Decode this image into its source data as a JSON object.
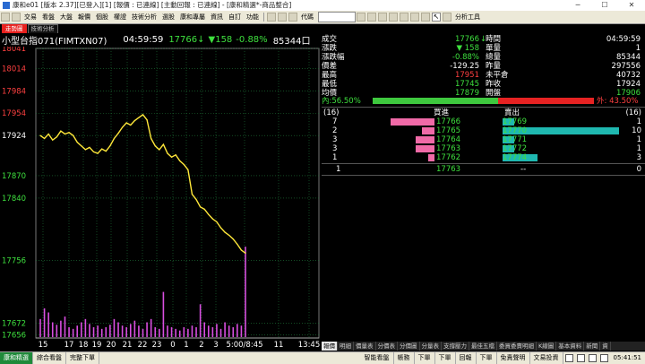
{
  "window": {
    "title": "康和e01 [版本 2.37][已登入][1] [報價 : 已連線] [主動回報 : 已連線] - [康和精選*-商品整合]",
    "minimize": "─",
    "maximize": "☐",
    "close": "✕"
  },
  "menu": {
    "items": [
      "交易",
      "看盤",
      "大盤",
      "報價",
      "個股",
      "權證",
      "技術分析",
      "選股",
      "康和專屬",
      "資訊",
      "自訂",
      "功能"
    ],
    "search_label": "代碼",
    "analysis_tools": "分析工具"
  },
  "tabs": [
    {
      "label": "走勢圖",
      "active": true
    },
    {
      "label": "技術分析",
      "active": false
    }
  ],
  "chart_header": {
    "name": "小型台指071(FIMTXN07)",
    "time": "04:59:59",
    "price": "17766",
    "arrow": "↓",
    "change": "▼158",
    "pct": "-0.88%",
    "volume": "85344口"
  },
  "chart_data": {
    "type": "line",
    "title": "",
    "xlabel": "",
    "ylabel": "",
    "ylim": [
      17652,
      18041
    ],
    "y_ticks": [
      "18041",
      "18014",
      "17984",
      "17954",
      "17924",
      "17870",
      "17840",
      "17756",
      "17672",
      "17656"
    ],
    "y_tick_values": [
      18041,
      18014,
      17984,
      17954,
      17924,
      17870,
      17840,
      17756,
      17672,
      17656
    ],
    "reference_price": 17924,
    "x_ticks": [
      "15",
      "17",
      "18",
      "19",
      "20",
      "21",
      "22",
      "23",
      "0",
      "1",
      "2",
      "3",
      "5:00/8:45",
      "11",
      "13:45"
    ],
    "price_series": [
      17924,
      17920,
      17926,
      17918,
      17922,
      17930,
      17926,
      17928,
      17924,
      17915,
      17910,
      17905,
      17908,
      17902,
      17900,
      17906,
      17903,
      17910,
      17920,
      17927,
      17935,
      17941,
      17938,
      17944,
      17948,
      17952,
      17945,
      17920,
      17910,
      17905,
      17912,
      17900,
      17895,
      17898,
      17890,
      17885,
      17878,
      17845,
      17838,
      17828,
      17825,
      17818,
      17812,
      17808,
      17800,
      17794,
      17790,
      17785,
      17778,
      17770,
      17766
    ],
    "volume_series": [
      22,
      35,
      30,
      18,
      15,
      20,
      25,
      12,
      10,
      14,
      18,
      22,
      16,
      12,
      14,
      10,
      12,
      15,
      22,
      18,
      14,
      12,
      16,
      20,
      14,
      10,
      18,
      22,
      12,
      10,
      55,
      14,
      12,
      10,
      8,
      12,
      10,
      14,
      12,
      40,
      18,
      14,
      12,
      16,
      10,
      18,
      14,
      12,
      16,
      14,
      110
    ],
    "volume_max": 120
  },
  "quote": {
    "left": [
      {
        "label": "成交",
        "value": "17766",
        "arrow": "↓",
        "color": "green"
      },
      {
        "label": "漲跌",
        "value": "▼ 158",
        "color": "green"
      },
      {
        "label": "漲跌幅",
        "value": "-0.88%",
        "color": "green"
      },
      {
        "label": "價差",
        "value": "-129.25",
        "color": "white"
      },
      {
        "label": "最高",
        "value": "17951",
        "color": "red"
      },
      {
        "label": "最低",
        "value": "17745",
        "color": "green"
      },
      {
        "label": "均價",
        "value": "17879",
        "color": "green"
      }
    ],
    "right": [
      {
        "label": "時間",
        "value": "04:59:59",
        "color": "white"
      },
      {
        "label": "單量",
        "value": "1",
        "color": "white"
      },
      {
        "label": "總量",
        "value": "85344",
        "color": "white"
      },
      {
        "label": "昨量",
        "value": "297556",
        "color": "white"
      },
      {
        "label": "未平倉",
        "value": "40732",
        "color": "white"
      },
      {
        "label": "昨收",
        "value": "17924",
        "color": "white"
      },
      {
        "label": "開盤",
        "value": "17906",
        "color": "green"
      }
    ],
    "in_label": "內:56.50%",
    "out_label": "外: 43.50%",
    "in_ratio": 0.565
  },
  "orderbook": {
    "bid_header": "買進",
    "ask_header": "賣出",
    "bid_total": "(16)",
    "ask_total": "(16)",
    "rows": [
      {
        "bid_qty": "7",
        "bid_price": "17766",
        "ask_price": "17769",
        "ask_qty": "1",
        "bid_share": 0.7,
        "ask_share": 0.1
      },
      {
        "bid_qty": "2",
        "bid_price": "17765",
        "ask_price": "17770",
        "ask_qty": "10",
        "bid_share": 0.2,
        "ask_share": 1.0
      },
      {
        "bid_qty": "3",
        "bid_price": "17764",
        "ask_price": "17771",
        "ask_qty": "1",
        "bid_share": 0.3,
        "ask_share": 0.1
      },
      {
        "bid_qty": "3",
        "bid_price": "17763",
        "ask_price": "17772",
        "ask_qty": "1",
        "bid_share": 0.3,
        "ask_share": 0.1
      },
      {
        "bid_qty": "1",
        "bid_price": "17762",
        "ask_price": "17774",
        "ask_qty": "3",
        "bid_share": 0.1,
        "ask_share": 0.3
      }
    ],
    "last": {
      "qty": "1",
      "price": "17763",
      "ask": "--",
      "ask_qty": "0"
    }
  },
  "bottom_tabs": [
    "報價",
    "明細",
    "價量表",
    "分價表",
    "分價圖",
    "分量表",
    "支撐壓力",
    "最佳五檔",
    "委買委賣明細",
    "K線圖",
    "基本資料",
    "新聞",
    "資"
  ],
  "statusbar": {
    "items": [
      "康和精選",
      "綜合看盤",
      "完整下單"
    ],
    "right_items": [
      "智能看盤",
      "帳務",
      "下單",
      "下單",
      "回報",
      "下單",
      "免責聲明",
      "文易投資"
    ],
    "clock": "05:41:51"
  },
  "colors": {
    "price_line": "#ffe83a",
    "volume": "#d94ee0",
    "grid": "#1f7a3a",
    "up": "#ff4040",
    "down": "#3ee03e"
  }
}
